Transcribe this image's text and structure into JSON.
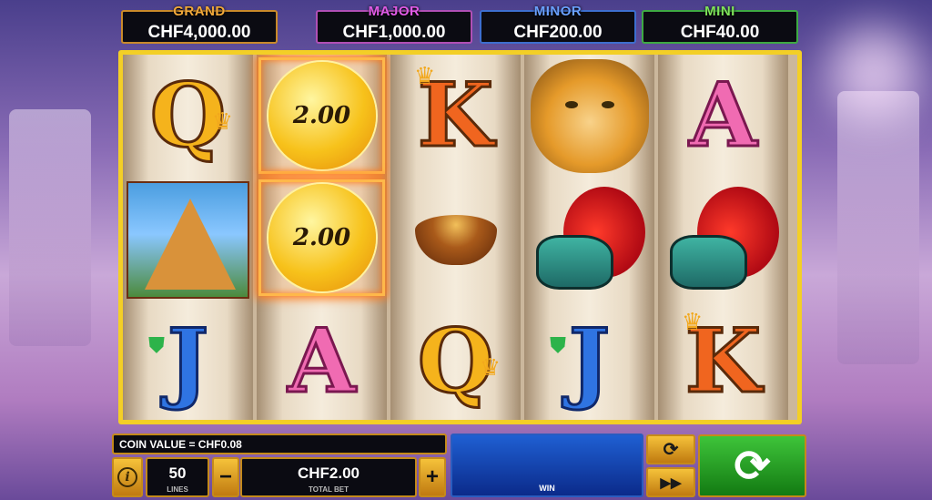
{
  "jackpots": {
    "grand": {
      "label": "GRAND",
      "value": "CHF4,000.00"
    },
    "major": {
      "label": "MAJOR",
      "value": "CHF1,000.00"
    },
    "minor": {
      "label": "MINOR",
      "value": "CHF200.00"
    },
    "mini": {
      "label": "MINI",
      "value": "CHF40.00"
    }
  },
  "reels": {
    "coin_values": [
      "2.00",
      "2.00"
    ],
    "symbols": {
      "letter_q": "Q",
      "letter_k": "K",
      "letter_a": "A",
      "letter_j": "J"
    }
  },
  "controls": {
    "coin_value": "COIN VALUE = CHF0.08",
    "lines_value": "50",
    "lines_label": "LINES",
    "total_bet_value": "CHF2.00",
    "total_bet_label": "TOTAL BET",
    "win_label": "WIN",
    "minus": "−",
    "plus": "+",
    "info": "i",
    "autoplay_icon": "⟳",
    "turbo_icon": "▶▶",
    "spin_icon": "⟳"
  },
  "colors": {
    "grand": "#f2a93b",
    "major": "#e05be6",
    "minor": "#6aa0ff",
    "mini": "#7fe35a",
    "frame": "#f3cf26",
    "spin": "#3ec43a"
  }
}
